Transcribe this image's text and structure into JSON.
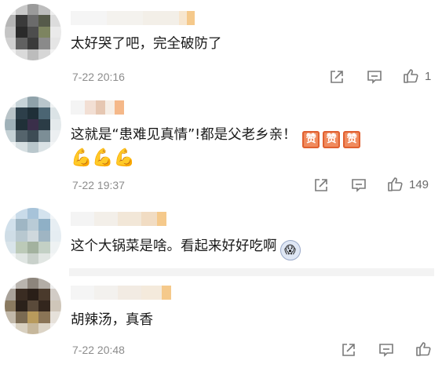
{
  "comments": [
    {
      "text": "太好哭了吧，完全破防了",
      "time": "7-22 20:16",
      "likes": "1"
    },
    {
      "text": "这就是“患难见真情”!都是父老乡亲！",
      "badges": [
        "赞",
        "赞",
        "赞"
      ],
      "emoji_arms": "💪💪💪",
      "time": "7-22 19:37",
      "likes": "149"
    },
    {
      "text": "这个大锅菜是啥。看起来好好吃啊",
      "emoji_face": "😱"
    },
    {
      "text": "胡辣汤，真香",
      "time": "7-22 20:48"
    }
  ],
  "icons": {
    "share": "share-icon",
    "reply": "comment-icon",
    "like": "thumbs-up-icon"
  },
  "colors": {
    "text": "#1a1a1a",
    "meta": "#8c8c8c",
    "icon": "#7a7a7a"
  }
}
